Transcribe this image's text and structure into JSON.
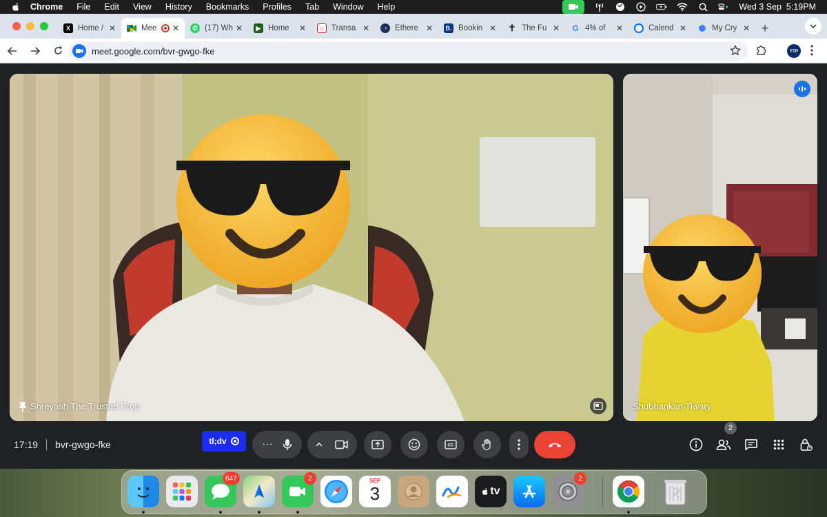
{
  "menubar": {
    "app": "Chrome",
    "items": [
      "File",
      "Edit",
      "View",
      "History",
      "Bookmarks",
      "Profiles",
      "Tab",
      "Window",
      "Help"
    ],
    "datetime": "Wed 3 Sep  5:19PM"
  },
  "tabs": [
    {
      "label": "Home /",
      "icon": "x-logo-icon",
      "color": "#000000"
    },
    {
      "label": "Mee",
      "icon": "google-meet-icon",
      "color": "#00897b",
      "active": true
    },
    {
      "label": "(17) Wh",
      "icon": "whatsapp-icon",
      "color": "#25d366"
    },
    {
      "label": "Home",
      "icon": "brand-icon",
      "color": "#1b5e20"
    },
    {
      "label": "Transa",
      "icon": "bank-icon",
      "color": "#c62828"
    },
    {
      "label": "Ethere",
      "icon": "etherscan-icon",
      "color": "#21325b"
    },
    {
      "label": "Bookin",
      "icon": "booking-icon",
      "color": "#003580"
    },
    {
      "label": "The Fu",
      "icon": "cross-icon",
      "color": "#333333"
    },
    {
      "label": "4% of",
      "icon": "google-icon",
      "color": "#4285f4"
    },
    {
      "label": "Calend",
      "icon": "calendly-icon",
      "color": "#006bff"
    },
    {
      "label": "My Cry",
      "icon": "cube-icon",
      "color": "#3b82f6"
    }
  ],
  "omnibox": {
    "url": "meet.google.com/bvr-gwgo-fke"
  },
  "profile": {
    "initials": "TTP"
  },
  "meeting": {
    "main_participant": "Shreyash The Trusted Prop",
    "side_participant": "Shubhankan Tiwary",
    "time": "17:19",
    "code": "bvr-gwgo-fke",
    "participant_count": "2",
    "tldv_label": "tl;dv"
  },
  "dock": {
    "messages_badge": "647",
    "facetime_badge": "2",
    "settings_badge": "2",
    "calendar_month": "SEP",
    "calendar_day": "3",
    "appletv_label": "tv"
  },
  "colors": {
    "end_call": "#ea4335",
    "accent": "#1a73e8",
    "tldv": "#1d2cf3"
  }
}
